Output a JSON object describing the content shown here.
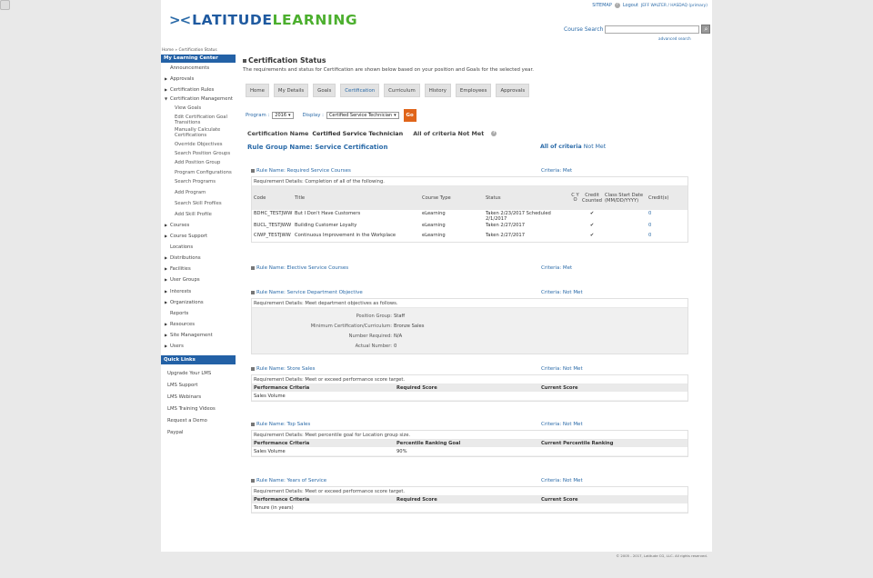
{
  "header": {
    "logo_word1": "LATITUDE",
    "logo_word2": "LEARNING",
    "sitemap": "SITEMAP",
    "logout": "Logout",
    "user": "JEFF WALTER / HASDAQ (primary)",
    "course_search_label": "Course Search",
    "advanced_search": "advanced search"
  },
  "breadcrumb": "Home » Certification Status",
  "sidebar": {
    "heading": "My Learning Center",
    "items": [
      {
        "label": "Announcements",
        "arrow": ""
      },
      {
        "label": "Approvals",
        "arrow": "▶"
      },
      {
        "label": "Certification Rules",
        "arrow": "▶"
      },
      {
        "label": "Certification Management",
        "arrow": "▼"
      },
      {
        "label": "View Goals"
      },
      {
        "label": "Edit Certification Goal Transitions"
      },
      {
        "label": "Manually Calculate Certifications"
      },
      {
        "label": "Override Objectives"
      },
      {
        "label": "Search Position Groups"
      },
      {
        "label": "Add Position Group"
      },
      {
        "label": "Program Configurations"
      },
      {
        "label": "Search Programs"
      },
      {
        "label": "Add Program"
      },
      {
        "label": "Search Skill Profiles"
      },
      {
        "label": "Add Skill Profile"
      },
      {
        "label": "Courses",
        "arrow": "▶"
      },
      {
        "label": "Course Support",
        "arrow": "▶"
      },
      {
        "label": "Locations",
        "arrow": ""
      },
      {
        "label": "Distributions",
        "arrow": "▶"
      },
      {
        "label": "Facilities",
        "arrow": "▶"
      },
      {
        "label": "User Groups",
        "arrow": "▶"
      },
      {
        "label": "Interests",
        "arrow": "▶"
      },
      {
        "label": "Organizations",
        "arrow": "▶"
      },
      {
        "label": "Reports",
        "arrow": ""
      },
      {
        "label": "Resources",
        "arrow": "▶"
      },
      {
        "label": "Site Management",
        "arrow": "▶"
      },
      {
        "label": "Users",
        "arrow": "▶"
      }
    ],
    "quick_links_heading": "Quick Links",
    "quick_links": [
      "Upgrade Your LMS",
      "LMS Support",
      "LMS Webinars",
      "LMS Training Videos",
      "Request a Demo",
      "Paypal"
    ]
  },
  "main": {
    "title": "Certification Status",
    "description": "The requirements and status for Certification are shown below based on your position and Goals for the selected year.",
    "tabs": [
      "Home",
      "My Details",
      "Goals",
      "Certification",
      "Curriculum",
      "History",
      "Employees",
      "Approvals"
    ],
    "active_tab": "Certification",
    "program_label": "Program :",
    "program_value": "2016",
    "display_label": "Display :",
    "display_value": "Certified Service Technician",
    "go": "Go",
    "cert_name_label": "Certification Name",
    "cert_name_value": "Certified Service Technician",
    "cert_status": "All of criteria Not Met",
    "rule_group": "Rule Group Name: Service Certification",
    "all_criteria_label": "All of criteria",
    "all_criteria_value": "Not Met"
  },
  "rules": {
    "required": {
      "name": "Rule Name: Required Service Courses",
      "criteria": "Criteria: Met",
      "details": "Requirement Details: Completion of all of the following.",
      "headers": [
        "Code",
        "Title",
        "Course Type",
        "Status",
        "C Y O",
        "Credit Counted",
        "Class Start Date (MM/DD/YYYY)",
        "Credit(s)"
      ],
      "rows": [
        {
          "code": "BDHC_TESTJWW",
          "title": "But I Don't Have Customers",
          "type": "eLearning",
          "status": "Taken 2/23/2017 Scheduled 2/1/2017",
          "cyo": "",
          "counted": "✔",
          "date": "",
          "credits": "0"
        },
        {
          "code": "BUCL_TESTJWW",
          "title": "Building Customer Loyalty",
          "type": "eLearning",
          "status": "Taken 2/27/2017",
          "cyo": "",
          "counted": "✔",
          "date": "",
          "credits": "0"
        },
        {
          "code": "CIWP_TESTJWW",
          "title": "Continuous Improvement in the Workplace",
          "type": "eLearning",
          "status": "Taken 2/27/2017",
          "cyo": "",
          "counted": "✔",
          "date": "",
          "credits": "0"
        }
      ]
    },
    "elective": {
      "name": "Rule Name: Elective Service Courses",
      "criteria": "Criteria: Met"
    },
    "objective": {
      "name": "Rule Name: Service Department Objective",
      "criteria": "Criteria: Not Met",
      "details": "Requirement Details: Meet department objectives as follows.",
      "rows": [
        {
          "k": "Position Group:",
          "v": "Staff"
        },
        {
          "k": "Minimum Certification/Curriculum:",
          "v": "Bronze Sales"
        },
        {
          "k": "Number Required:",
          "v": "N/A"
        },
        {
          "k": "Actual Number:",
          "v": "0"
        }
      ]
    },
    "store_sales": {
      "name": "Rule Name: Store Sales",
      "criteria": "Criteria: Not Met",
      "details": "Requirement Details: Meet or exceed performance score target.",
      "headers": [
        "Performance Criteria",
        "Required Score",
        "Current Score"
      ],
      "row": [
        "Sales Volume",
        "",
        ""
      ]
    },
    "top_sales": {
      "name": "Rule Name: Top Sales",
      "criteria": "Criteria: Not Met",
      "details": "Requirement Details: Meet percentile goal for Location group size.",
      "headers": [
        "Performance Criteria",
        "Percentile Ranking Goal",
        "Current Percentile Ranking"
      ],
      "row": [
        "Sales Volume",
        "90%",
        ""
      ]
    },
    "years": {
      "name": "Rule Name: Years of Service",
      "criteria": "Criteria: Not Met",
      "details": "Requirement Details: Meet or exceed performance score target.",
      "headers": [
        "Performance Criteria",
        "Required Score",
        "Current Score"
      ],
      "row": [
        "Tenure (in years)",
        "",
        ""
      ]
    }
  },
  "footer": "© 2005 - 2017, Latitude CG, LLC. All rights reserved."
}
